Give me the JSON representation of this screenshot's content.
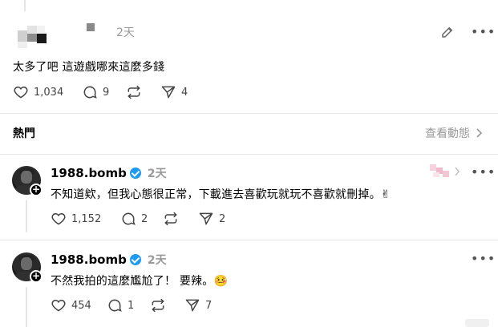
{
  "post": {
    "time": "2天",
    "text": "太多了吧 這遊戲哪來這麼多錢",
    "likes": "1,034",
    "comments": "9",
    "shares": "4"
  },
  "section": {
    "title": "熱門",
    "activity_link": "查看動態"
  },
  "replies": [
    {
      "username": "1988.bomb",
      "time": "2天",
      "text": "不知道欸，但我心態很正常，下載進去喜歡玩就玩不喜歡就刪掉。✌",
      "likes": "1,152",
      "comments": "2",
      "shares": "2"
    },
    {
      "username": "1988.bomb",
      "time": "2天",
      "text": "不然我拍的這麼尷尬了！ 要辣。🤒",
      "likes": "454",
      "comments": "1",
      "shares": "7"
    }
  ],
  "icons": {
    "like": "heart-icon",
    "comment": "comment-bubble-icon",
    "repost": "repost-icon",
    "share": "send-icon",
    "edit": "pencil-icon",
    "more": "more-dots-icon",
    "chevron": "chevron-right-icon",
    "verified": "verified-badge-icon"
  },
  "colors": {
    "verified": "#1d9bf0",
    "muted_text": "#999999",
    "divider": "#e6e6e6"
  }
}
